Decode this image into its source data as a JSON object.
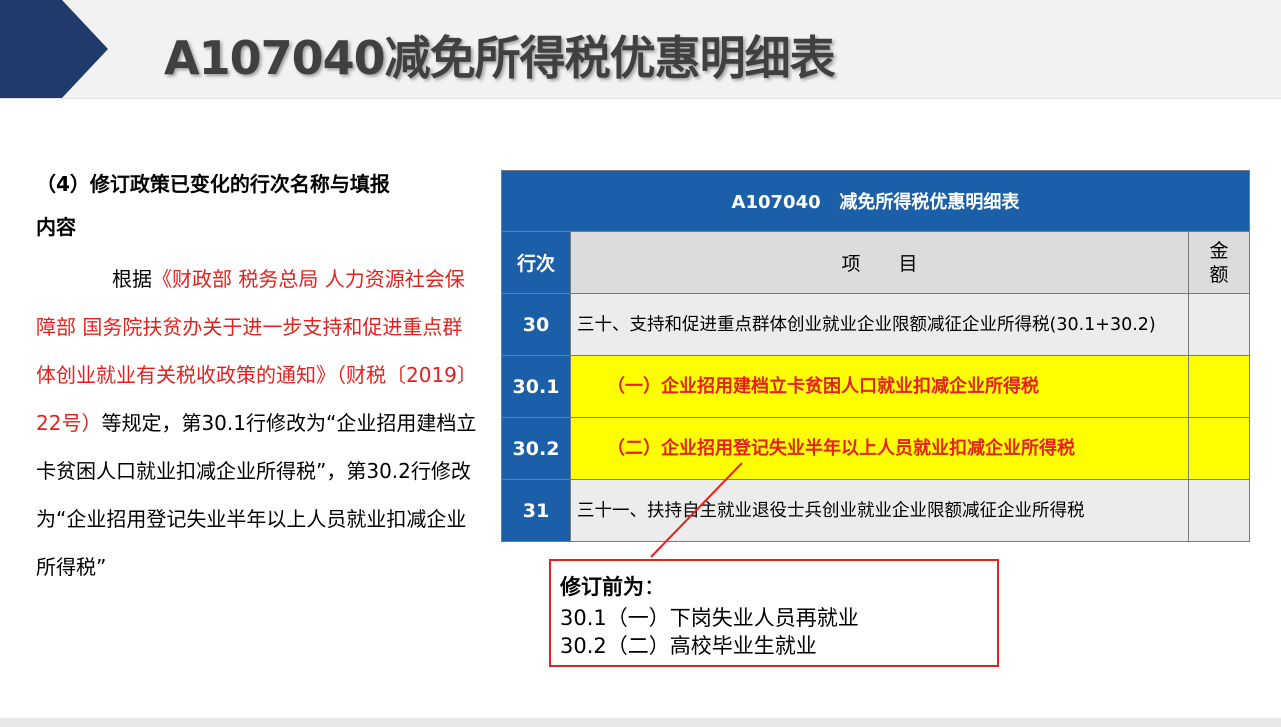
{
  "slide": {
    "title": "A107040减免所得税优惠明细表",
    "colors": {
      "accent_blue": "#1b5fa8",
      "highlight": "#ffff00",
      "red": "#e5211e"
    }
  },
  "left": {
    "heading_line1": "（4）修订政策已变化的行次名称与填报",
    "heading_line2": "内容",
    "body_prefix": "根据",
    "body_red": "《财政部 税务总局 人力资源社会保障部 国务院扶贫办关于进一步支持和促进重点群体创业就业有关税收政策的通知》（财税〔2019〕22号）",
    "body_rest": "等规定，第30.1行修改为“企业招用建档立卡贫困人口就业扣减企业所得税”，第30.2行修改为“企业招用登记失业半年以上人员就业扣减企业所得税”"
  },
  "table": {
    "title": "A107040   减免所得税优惠明细表",
    "headers": {
      "row_no": "行次",
      "item": "项　　目",
      "amount": "金额"
    },
    "rows": [
      {
        "no": "30",
        "item": "三十、支持和促进重点群体创业就业企业限额减征企业所得税(30.1+30.2)",
        "amount": ""
      },
      {
        "no": "30.1",
        "item": "（一）企业招用建档立卡贫困人口就业扣减企业所得税",
        "amount": ""
      },
      {
        "no": "30.2",
        "item": "（二）企业招用登记失业半年以上人员就业扣减企业所得税",
        "amount": ""
      },
      {
        "no": "31",
        "item": "三十一、扶持自主就业退役士兵创业就业企业限额减征企业所得税",
        "amount": ""
      }
    ]
  },
  "note": {
    "title": "修订前为",
    "colon": "：",
    "line1": "30.1（一）下岗失业人员再就业",
    "line2": "30.2（二）高校毕业生就业"
  }
}
